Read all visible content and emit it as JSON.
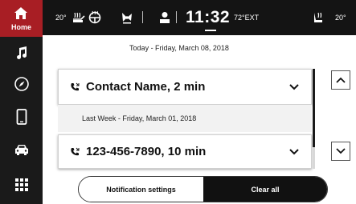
{
  "sidebar": {
    "home_label": "Home",
    "items": [
      {
        "icon": "music-note-icon"
      },
      {
        "icon": "compass-icon"
      },
      {
        "icon": "phone-icon"
      },
      {
        "icon": "car-icon"
      },
      {
        "icon": "apps-grid-icon"
      }
    ]
  },
  "status_bar": {
    "left_temp": "20°",
    "time": "11:32",
    "ext_temp": "72°EXT",
    "right_temp": "20°"
  },
  "notifications": {
    "today_header": "Today - Friday, March 08, 2018",
    "items": [
      {
        "title": "Contact Name, 2 min"
      },
      {
        "title": "123-456-7890, 10 min"
      }
    ],
    "last_week_header": "Last Week - Friday, March 01, 2018"
  },
  "actions": {
    "notification_settings": "Notification settings",
    "clear_all": "Clear all"
  },
  "colors": {
    "accent": "#a81e24",
    "sidebar_bg": "#1a1a1a",
    "status_bg": "#141414"
  }
}
